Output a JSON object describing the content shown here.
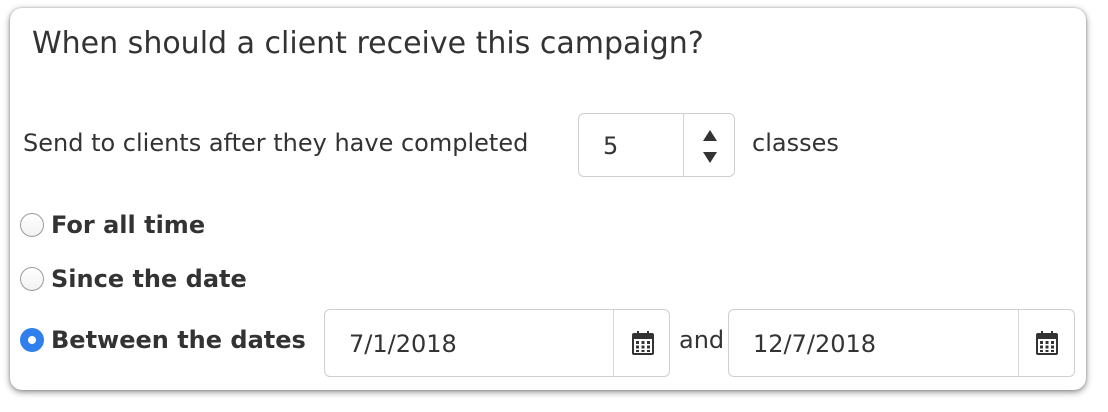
{
  "section": {
    "title": "When should a client receive this campaign?"
  },
  "send_rule": {
    "prefix": "Send to clients after they have completed",
    "count": "5",
    "suffix": "classes"
  },
  "options": [
    {
      "label": "For all time",
      "checked": false
    },
    {
      "label": "Since the date",
      "checked": false
    },
    {
      "label": "Between the dates",
      "checked": true
    }
  ],
  "date_range": {
    "start": "7/1/2018",
    "joiner": "and",
    "end": "12/7/2018"
  },
  "colors": {
    "accent": "#2f80ed",
    "text": "#333333",
    "border": "#cfcfcf"
  },
  "icons": {
    "stepper_up": "arrow-up-icon",
    "stepper_down": "arrow-down-icon",
    "calendar": "calendar-icon"
  }
}
